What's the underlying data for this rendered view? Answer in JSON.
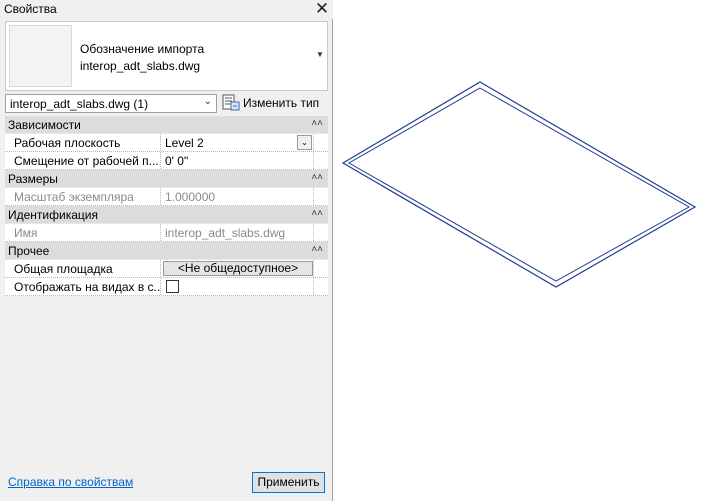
{
  "window": {
    "title": "Свойства"
  },
  "type_selector": {
    "line1": "Обозначение импорта",
    "line2": "interop_adt_slabs.dwg"
  },
  "instance_combo": {
    "value": "interop_adt_slabs.dwg (1)"
  },
  "edit_type": {
    "label": "Изменить тип"
  },
  "groups": {
    "constraints": {
      "label": "Зависимости",
      "props": [
        {
          "name": "Рабочая плоскость",
          "value": "Level 2"
        },
        {
          "name": "Смещение от рабочей п...",
          "value": "0'  0\""
        }
      ]
    },
    "dimensions": {
      "label": "Размеры",
      "props": [
        {
          "name": "Масштаб экземпляра",
          "value": "1.000000"
        }
      ]
    },
    "identity": {
      "label": "Идентификация",
      "props": [
        {
          "name": "Имя",
          "value": "interop_adt_slabs.dwg"
        }
      ]
    },
    "other": {
      "label": "Прочее",
      "props": [
        {
          "name": "Общая площадка",
          "value": "<Не общедоступное>"
        },
        {
          "name": "Отображать на видах в с...",
          "value_checked": false
        }
      ]
    }
  },
  "footer": {
    "help_link": "Справка по свойствам",
    "apply_button": "Применить"
  },
  "colors": {
    "link": "#0066cc",
    "slab_edge": "#1f3f8f",
    "group_header": "#dcdcdc"
  },
  "icons": {
    "close": "close-icon",
    "edit_type": "edit-type-icon",
    "collapse": "collapse-icon",
    "dropdown": "chevron-down-icon"
  }
}
